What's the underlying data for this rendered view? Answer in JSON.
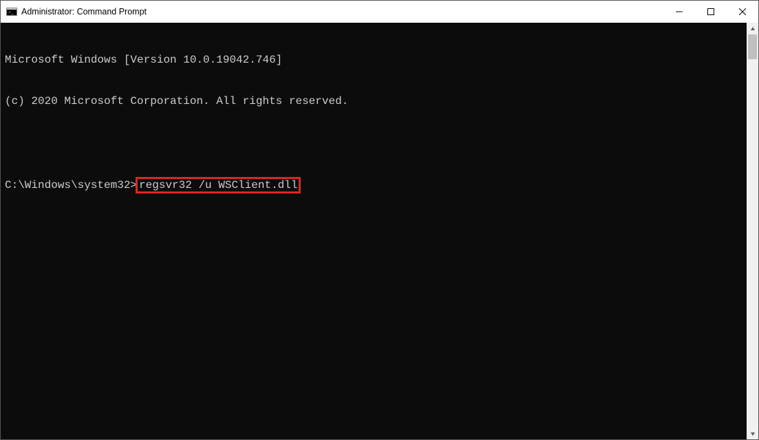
{
  "window": {
    "title": "Administrator: Command Prompt"
  },
  "terminal": {
    "line1": "Microsoft Windows [Version 10.0.19042.746]",
    "line2": "(c) 2020 Microsoft Corporation. All rights reserved.",
    "blank": "",
    "prompt": "C:\\Windows\\system32>",
    "command": "regsvr32 /u WSClient.dll"
  }
}
